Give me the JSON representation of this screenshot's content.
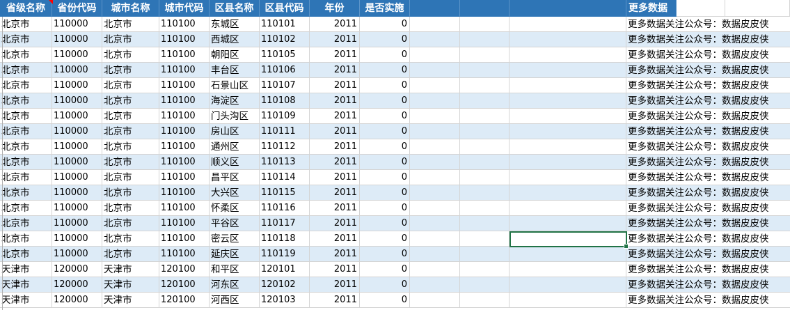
{
  "headers": [
    "省级名称",
    "省份代码",
    "城市名称",
    "城市代码",
    "区县名称",
    "区县代码",
    "年份",
    "是否实施",
    "",
    "",
    "",
    "更多数据"
  ],
  "more_text": "更多数据关注公众号：数据皮皮侠",
  "rows": [
    [
      "北京市",
      "110000",
      "北京市",
      "110100",
      "东城区",
      "110101",
      "2011",
      "0"
    ],
    [
      "北京市",
      "110000",
      "北京市",
      "110100",
      "西城区",
      "110102",
      "2011",
      "0"
    ],
    [
      "北京市",
      "110000",
      "北京市",
      "110100",
      "朝阳区",
      "110105",
      "2011",
      "0"
    ],
    [
      "北京市",
      "110000",
      "北京市",
      "110100",
      "丰台区",
      "110106",
      "2011",
      "0"
    ],
    [
      "北京市",
      "110000",
      "北京市",
      "110100",
      "石景山区",
      "110107",
      "2011",
      "0"
    ],
    [
      "北京市",
      "110000",
      "北京市",
      "110100",
      "海淀区",
      "110108",
      "2011",
      "0"
    ],
    [
      "北京市",
      "110000",
      "北京市",
      "110100",
      "门头沟区",
      "110109",
      "2011",
      "0"
    ],
    [
      "北京市",
      "110000",
      "北京市",
      "110100",
      "房山区",
      "110111",
      "2011",
      "0"
    ],
    [
      "北京市",
      "110000",
      "北京市",
      "110100",
      "通州区",
      "110112",
      "2011",
      "0"
    ],
    [
      "北京市",
      "110000",
      "北京市",
      "110100",
      "顺义区",
      "110113",
      "2011",
      "0"
    ],
    [
      "北京市",
      "110000",
      "北京市",
      "110100",
      "昌平区",
      "110114",
      "2011",
      "0"
    ],
    [
      "北京市",
      "110000",
      "北京市",
      "110100",
      "大兴区",
      "110115",
      "2011",
      "0"
    ],
    [
      "北京市",
      "110000",
      "北京市",
      "110100",
      "怀柔区",
      "110116",
      "2011",
      "0"
    ],
    [
      "北京市",
      "110000",
      "北京市",
      "110100",
      "平谷区",
      "110117",
      "2011",
      "0"
    ],
    [
      "北京市",
      "110000",
      "北京市",
      "110100",
      "密云区",
      "110118",
      "2011",
      "0"
    ],
    [
      "北京市",
      "110000",
      "北京市",
      "110100",
      "延庆区",
      "110119",
      "2011",
      "0"
    ],
    [
      "天津市",
      "120000",
      "天津市",
      "120100",
      "和平区",
      "120101",
      "2011",
      "0"
    ],
    [
      "天津市",
      "120000",
      "天津市",
      "120100",
      "河东区",
      "120102",
      "2011",
      "0"
    ],
    [
      "天津市",
      "120000",
      "天津市",
      "120100",
      "河西区",
      "120103",
      "2011",
      "0"
    ]
  ],
  "colors": {
    "header_bg": "#2e75b6",
    "header_text": "#ffffff",
    "band": "#ddebf7",
    "selection": "#217346",
    "gridline": "#d4d4d4"
  }
}
